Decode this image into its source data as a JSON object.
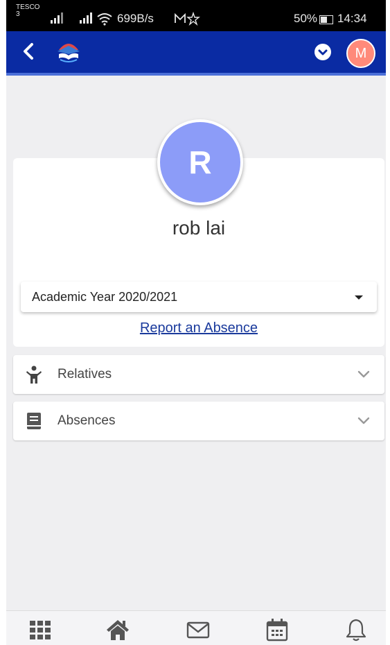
{
  "status_bar": {
    "carrier": "TESCO",
    "carrier_sub": "3",
    "net_speed": "699B/s",
    "battery": "50%",
    "time": "14:34"
  },
  "header": {
    "user_initial": "M",
    "colors": {
      "bar": "#0a2ba3",
      "avatar": "#ff8a7a"
    }
  },
  "profile": {
    "initial": "R",
    "name": "rob lai",
    "avatar_color": "#8c9cf8"
  },
  "year_select": {
    "selected": "Academic Year 2020/2021"
  },
  "report_link": "Report an Absence",
  "sections": [
    {
      "label": "Relatives",
      "icon": "person-icon"
    },
    {
      "label": "Absences",
      "icon": "book-icon"
    }
  ],
  "bottom_nav": [
    {
      "icon": "grid-icon"
    },
    {
      "icon": "home-icon"
    },
    {
      "icon": "mail-icon"
    },
    {
      "icon": "calendar-icon"
    },
    {
      "icon": "bell-icon"
    }
  ]
}
